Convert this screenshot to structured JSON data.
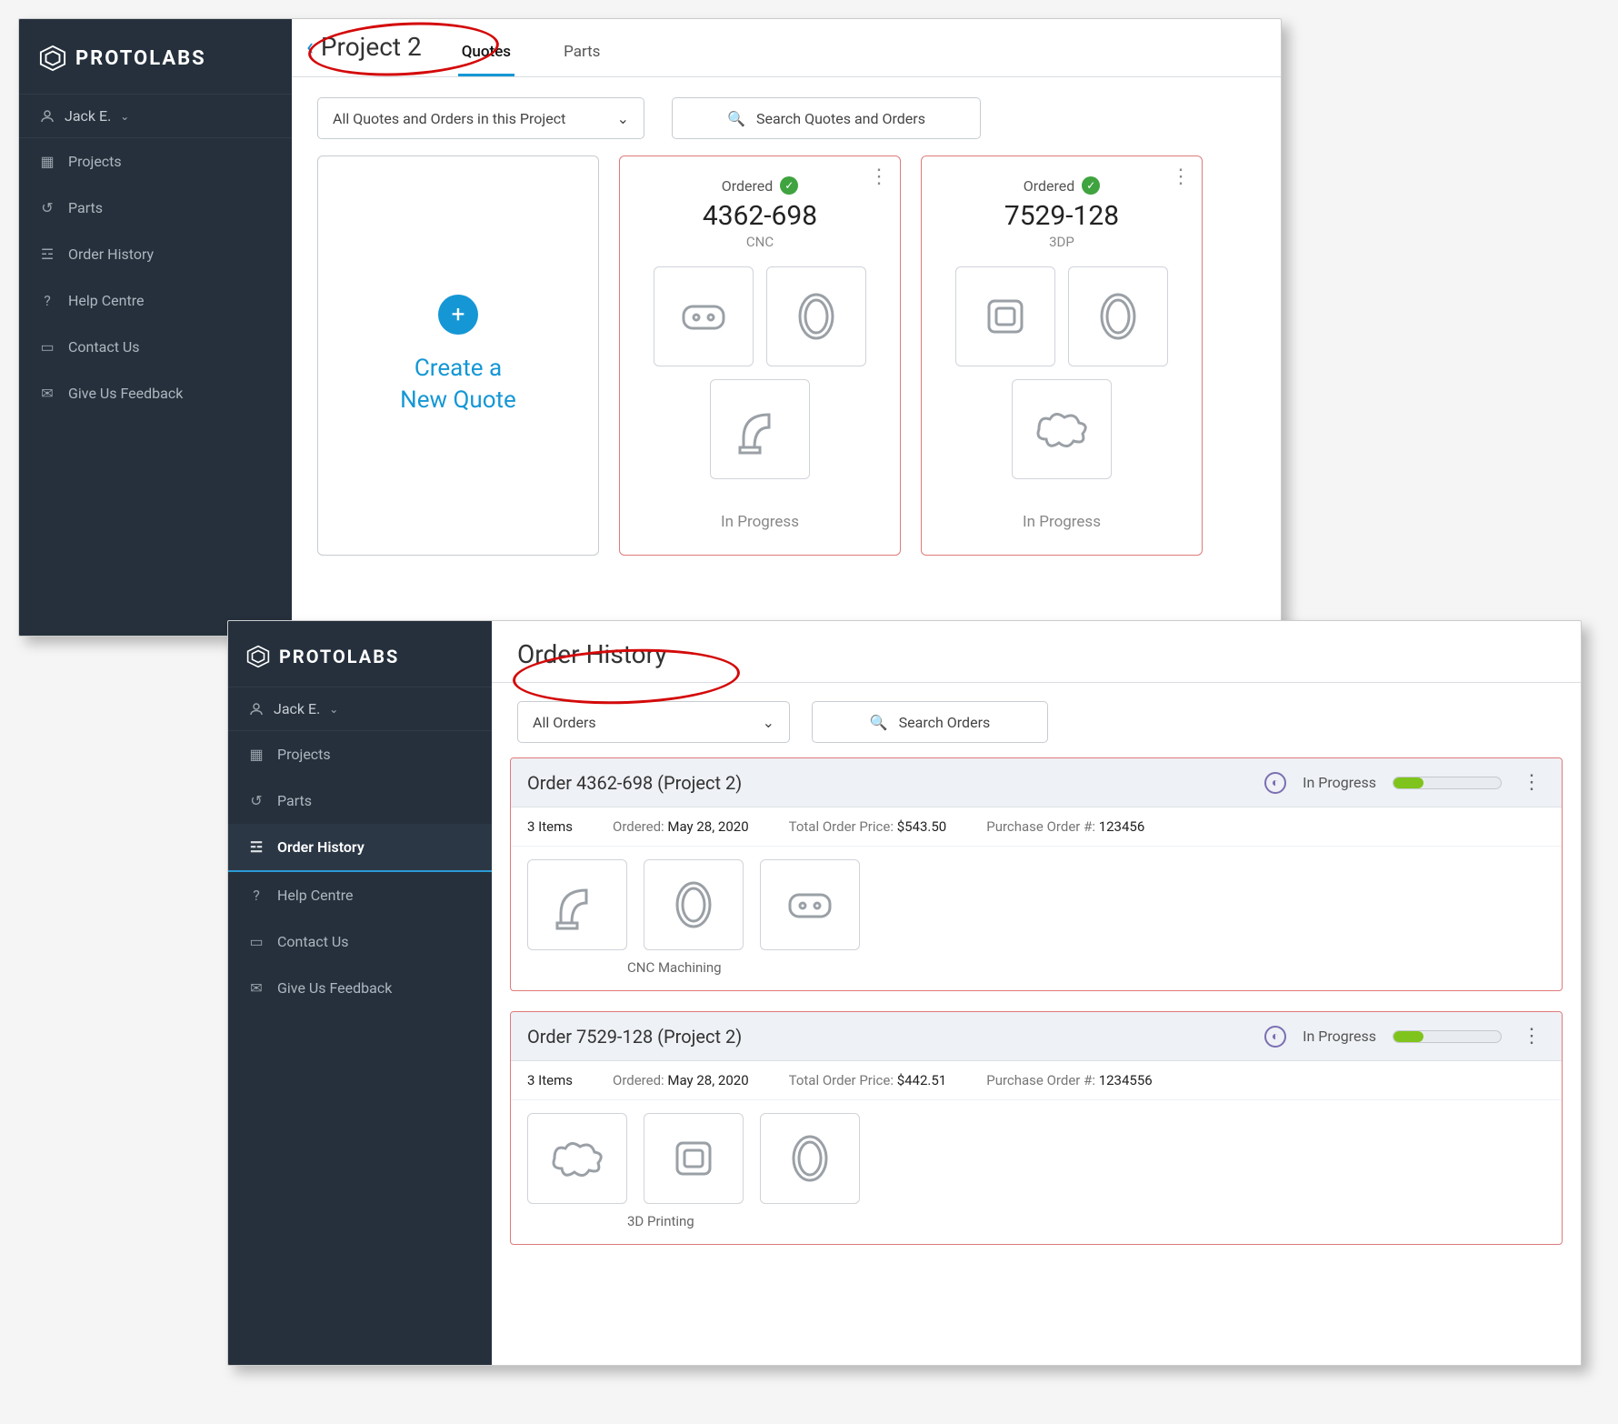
{
  "brand": "PROTOLABS",
  "user": {
    "name": "Jack E."
  },
  "sidebar": {
    "items": [
      {
        "label": "Projects"
      },
      {
        "label": "Parts"
      },
      {
        "label": "Order History"
      },
      {
        "label": "Help Centre"
      },
      {
        "label": "Contact Us"
      },
      {
        "label": "Give Us Feedback"
      }
    ]
  },
  "window1": {
    "project_title": "Project 2",
    "tabs": {
      "quotes": "Quotes",
      "parts": "Parts"
    },
    "filter_label": "All Quotes and Orders in this Project",
    "search_placeholder": "Search Quotes and Orders",
    "new_quote_line1": "Create a",
    "new_quote_line2": "New Quote",
    "cards": [
      {
        "status": "Ordered",
        "number": "4362-698",
        "process": "CNC",
        "footer": "In Progress"
      },
      {
        "status": "Ordered",
        "number": "7529-128",
        "process": "3DP",
        "footer": "In Progress"
      }
    ]
  },
  "window2": {
    "title": "Order History",
    "filter_label": "All Orders",
    "search_placeholder": "Search Orders",
    "orders": [
      {
        "title": "Order 4362-698 (Project 2)",
        "status": "In Progress",
        "items_label": "3 Items",
        "ordered_label": "Ordered:",
        "ordered_date": "May 28, 2020",
        "price_label": "Total Order Price:",
        "price": "$543.50",
        "po_label": "Purchase Order #:",
        "po": "123456",
        "process": "CNC Machining"
      },
      {
        "title": "Order 7529-128 (Project 2)",
        "status": "In Progress",
        "items_label": "3 Items",
        "ordered_label": "Ordered:",
        "ordered_date": "May 28, 2020",
        "price_label": "Total Order Price:",
        "price": "$442.51",
        "po_label": "Purchase Order #:",
        "po": "1234556",
        "process": "3D Printing"
      }
    ]
  }
}
